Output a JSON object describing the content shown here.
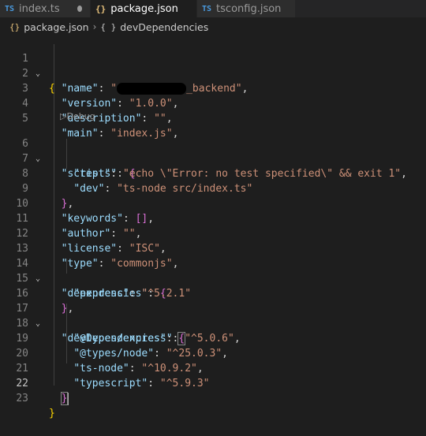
{
  "tabs": [
    {
      "icon": "TS",
      "label": "index.ts",
      "modified": true
    },
    {
      "icon": "{}",
      "label": "package.json",
      "modified": true,
      "active": true
    },
    {
      "icon": "TS",
      "label": "tsconfig.json"
    }
  ],
  "breadcrumb": [
    {
      "icon": "{}",
      "label": "package.json"
    },
    {
      "icon": "{ }",
      "label": "devDependencies"
    }
  ],
  "codelens": "Debug",
  "lines": [
    {
      "n": "1"
    },
    {
      "n": "2"
    },
    {
      "n": "3"
    },
    {
      "n": "4"
    },
    {
      "n": "5"
    },
    {
      "n": "6"
    },
    {
      "n": "7"
    },
    {
      "n": "8"
    },
    {
      "n": "9"
    },
    {
      "n": "10"
    },
    {
      "n": "11"
    },
    {
      "n": "12"
    },
    {
      "n": "13"
    },
    {
      "n": "14"
    },
    {
      "n": "15"
    },
    {
      "n": "16"
    },
    {
      "n": "17"
    },
    {
      "n": "18"
    },
    {
      "n": "19"
    },
    {
      "n": "20"
    },
    {
      "n": "21"
    },
    {
      "n": "22"
    },
    {
      "n": "23"
    }
  ],
  "json": {
    "name_key": "\"name\"",
    "name_val_end": "_backend\"",
    "version_key": "\"version\"",
    "version_val": "\"1.0.0\"",
    "description_key": "\"description\"",
    "description_val": "\"\"",
    "main_key": "\"main\"",
    "main_val": "\"index.js\"",
    "scripts_key": "\"scripts\"",
    "test_key": "\"test\"",
    "test_val": "\"echo \\\"Error: no test specified\\\" && exit 1\"",
    "dev_key": "\"dev\"",
    "dev_val": "\"ts-node src/index.ts\"",
    "keywords_key": "\"keywords\"",
    "author_key": "\"author\"",
    "author_val": "\"\"",
    "license_key": "\"license\"",
    "license_val": "\"ISC\"",
    "type_key": "\"type\"",
    "type_val": "\"commonjs\"",
    "dependencies_key": "\"dependencies\"",
    "express_key": "\"express\"",
    "express_val": "\"^5.2.1\"",
    "devDependencies_key": "\"devDependencies\"",
    "types_express_key": "\"@types/express\"",
    "types_express_val": "\"^5.0.6\"",
    "types_node_key": "\"@types/node\"",
    "types_node_val": "\"^25.0.3\"",
    "ts_node_key": "\"ts-node\"",
    "ts_node_val": "\"^10.9.2\"",
    "typescript_key": "\"typescript\"",
    "typescript_val": "\"^5.9.3\""
  },
  "colors": {
    "background": "#1e1e1e",
    "key": "#9cdcfe",
    "string": "#ce9178",
    "bracket1": "#ffd700",
    "bracket2": "#da70d6"
  }
}
